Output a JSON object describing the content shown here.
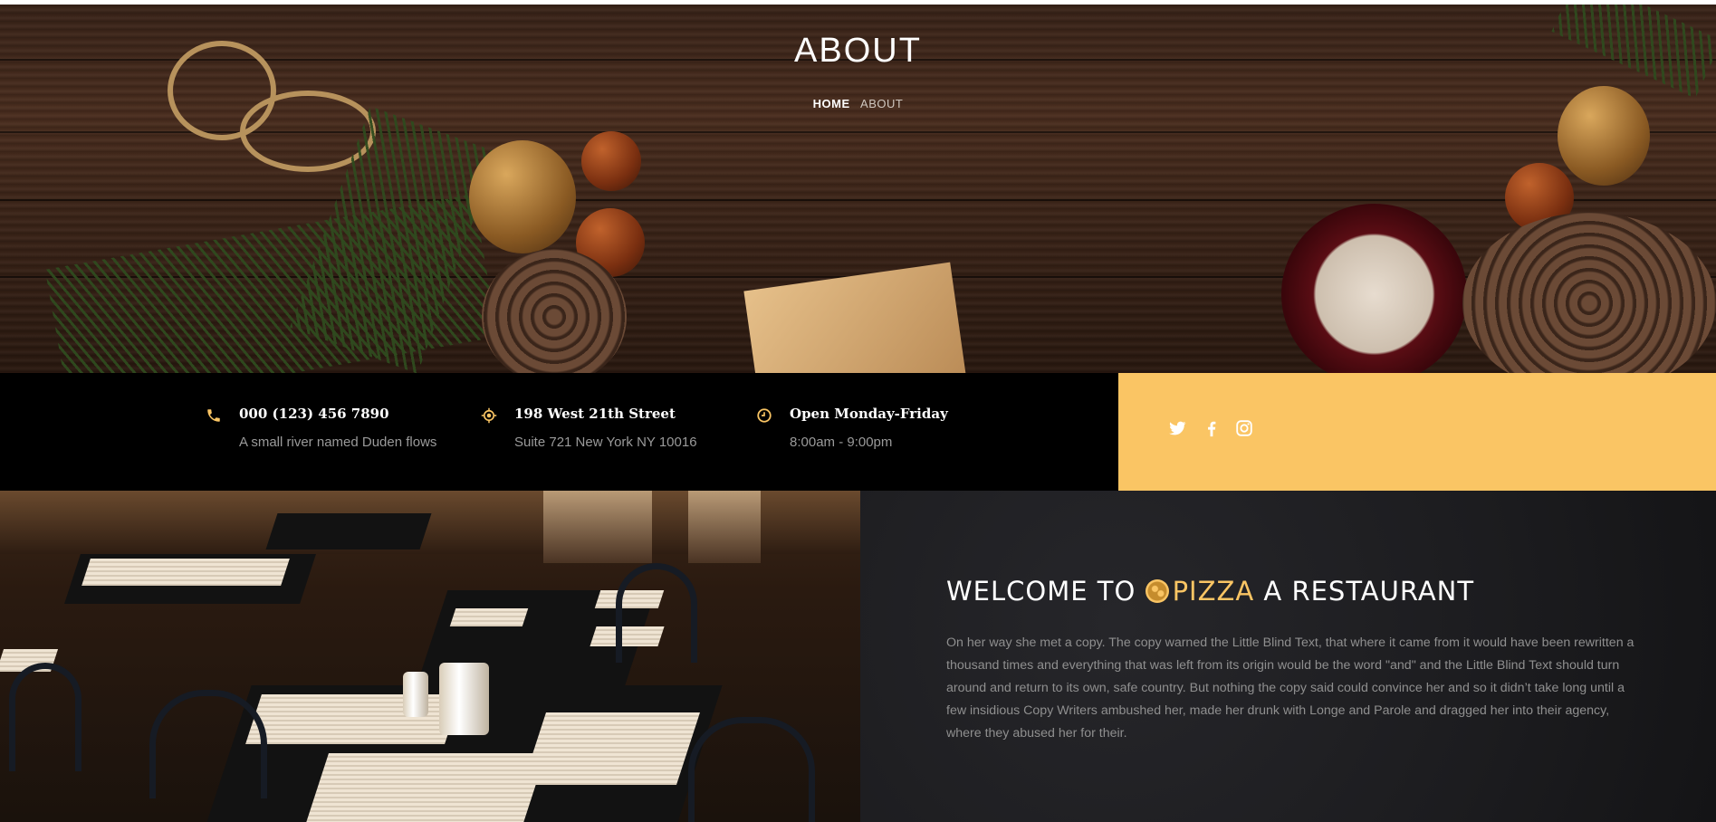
{
  "hero": {
    "title": "ABOUT",
    "breadcrumb": {
      "home": "HOME",
      "current": "ABOUT"
    }
  },
  "contact": {
    "phone": {
      "icon": "phone-icon",
      "title": "000 (123) 456 7890",
      "subtitle": "A small river named Duden flows"
    },
    "address": {
      "icon": "location-icon",
      "title": "198 West 21th Street",
      "subtitle": "Suite 721 New York NY 10016"
    },
    "hours": {
      "icon": "clock-icon",
      "title": "Open Monday-Friday",
      "subtitle": "8:00am - 9:00pm"
    }
  },
  "social": [
    {
      "icon": "twitter-icon"
    },
    {
      "icon": "facebook-icon"
    },
    {
      "icon": "instagram-icon"
    }
  ],
  "welcome": {
    "prefix": "WELCOME TO",
    "brand": "PIZZA",
    "suffix": "A RESTAURANT",
    "text": "On her way she met a copy. The copy warned the Little Blind Text, that where it came from it would have been rewritten a thousand times and everything that was left from its origin would be the word \"and\" and the Little Blind Text should turn around and return to its own, safe country. But nothing the copy said could convince her and so it didn’t take long until a few insidious Copy Writers ambushed her, made her drunk with Longe and Parole and dragged her into their agency, where they abused her for their."
  },
  "colors": {
    "accent": "#fac564",
    "dark": "#000000",
    "text_muted": "#9a9a9a"
  }
}
